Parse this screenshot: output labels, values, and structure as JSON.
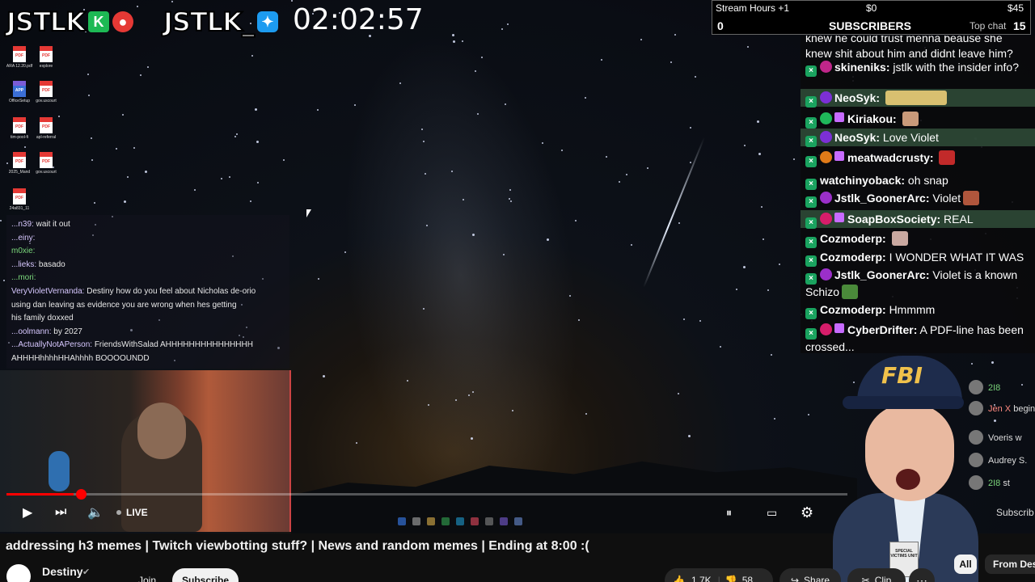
{
  "stream": {
    "brand_left": "JSTLK",
    "brand_left_badge": "K",
    "brand_right": "JSTLK_",
    "clock": "02:02:57"
  },
  "stats": {
    "stream_hours_label": "Stream Hours +1",
    "amount_mid": "$0",
    "amount_right": "$45",
    "subscribers_label": "SUBSCRIBERS",
    "subscribers_count": "0",
    "top_chat_label": "Top chat",
    "top_chat_count": "15"
  },
  "desktop_files": [
    {
      "type": "PDF",
      "name": "ARA 12.20.pdf"
    },
    {
      "type": "PDF",
      "name": "explore"
    },
    {
      "type": "APP",
      "name": "OfficeSetup"
    },
    {
      "type": "PDF",
      "name": "gov.uscourt"
    },
    {
      "type": "PDF",
      "name": "tim-pool-fi"
    },
    {
      "type": "PDF",
      "name": "apl-referral"
    },
    {
      "type": "PDF",
      "name": "2025_Mand"
    },
    {
      "type": "PDF",
      "name": "gov.uscourt"
    },
    {
      "type": "PDF",
      "name": "24a831_11"
    }
  ],
  "overlay_chat": [
    {
      "user": "...n39:",
      "text": "wait it out",
      "color": "lavender"
    },
    {
      "user": "...einy:",
      "text": "",
      "color": "lavender"
    },
    {
      "user": "m0xie:",
      "text": "",
      "color": "green"
    },
    {
      "user": "...lieks:",
      "text": "basado",
      "color": "lavender"
    },
    {
      "user": "...mori:",
      "text": "",
      "color": "green"
    },
    {
      "user": "VeryVioletVernanda:",
      "text": "Destiny how do you feel about Nicholas de-orio",
      "color": "lavender"
    },
    {
      "user": "",
      "text": "using dan leaving as evidence you are wrong when hes getting",
      "color": "lavender"
    },
    {
      "user": "",
      "text": "his family doxxed",
      "color": "lavender"
    },
    {
      "user": "...oolmann:",
      "text": "by 2027",
      "color": "lavender"
    },
    {
      "user": "...ActuallyNotAPerson:",
      "text": "FriendsWithSalad AHHHHHHHHHHHHHHH",
      "color": "lavender"
    },
    {
      "user": "",
      "text": "AHHHHhhhhHHAhhhh BOOOOUNDD",
      "color": "lavender"
    }
  ],
  "chat": {
    "top_cut": "knew he could trust menna beause she knew shit about him and didnt leave him?",
    "messages": [
      {
        "user": "skineniks:",
        "text": "jstlk with the insider info?",
        "dot": "#c0268a",
        "sub": false,
        "hl": false
      },
      {
        "user": "NeoSyk:",
        "text": "",
        "dot": "#7c2fd6",
        "sub": false,
        "hl": true
      },
      {
        "user": "Kiriakou:",
        "text": "",
        "dot": "#1fb85a",
        "sub": true,
        "hl": false
      },
      {
        "user": "NeoSyk:",
        "text": "Love Violet",
        "dot": "#7c2fd6",
        "sub": false,
        "hl": true
      },
      {
        "user": "meatwadcrusty:",
        "text": "",
        "dot": "#e07a18",
        "sub": true,
        "hl": false
      },
      {
        "user": "watchinyoback:",
        "text": "oh snap",
        "dot": "",
        "sub": false,
        "hl": false
      },
      {
        "user": "Jstlk_GoonerArc:",
        "text": "Violet",
        "dot": "#9b2fc9",
        "sub": false,
        "hl": false
      },
      {
        "user": "SoapBoxSociety:",
        "text": "REAL",
        "dot": "#d61d6a",
        "sub": true,
        "hl": true
      },
      {
        "user": "Cozmoderp:",
        "text": "",
        "dot": "",
        "sub": false,
        "hl": false
      },
      {
        "user": "Cozmoderp:",
        "text": "I WONDER WHAT IT WAS",
        "dot": "",
        "sub": false,
        "hl": false
      },
      {
        "user": "Jstlk_GoonerArc:",
        "text": "Violet is a known Schizo",
        "dot": "#9b2fc9",
        "sub": false,
        "hl": false
      },
      {
        "user": "Cozmoderp:",
        "text": "Hmmmm",
        "dot": "",
        "sub": false,
        "hl": false
      },
      {
        "user": "CyberDrifter:",
        "text": "A PDF-line has been crossed...",
        "dot": "#d61d6a",
        "sub": true,
        "hl": false
      }
    ]
  },
  "yt_side_chat": [
    {
      "user": "2I8",
      "text": ""
    },
    {
      "user": "Jen X",
      "text": "beginning"
    },
    {
      "user": "Voeris",
      "text": "w"
    },
    {
      "user": "Audrey S.",
      "text": ""
    },
    {
      "user": "2I8",
      "text": "st"
    }
  ],
  "player": {
    "live_label": "LIVE",
    "progress": 0.08,
    "subscribe_side": "Subscrib"
  },
  "video": {
    "title": "addressing h3 memes | Twitch viewbotting stuff? | News and random memes | Ending at 8:00 :(",
    "channel": "Destiny",
    "join_label": "Join",
    "subscribe_label": "Subscribe",
    "likes": "1.7K",
    "dislikes": "58",
    "share_label": "Share",
    "clip_label": "Clip",
    "more_label": "⋯"
  },
  "chips": {
    "all": "All",
    "from": "From Des"
  },
  "fbi": {
    "hat_text": "FBI",
    "badge_text": "SPECIAL VICTIMS UNIT"
  }
}
